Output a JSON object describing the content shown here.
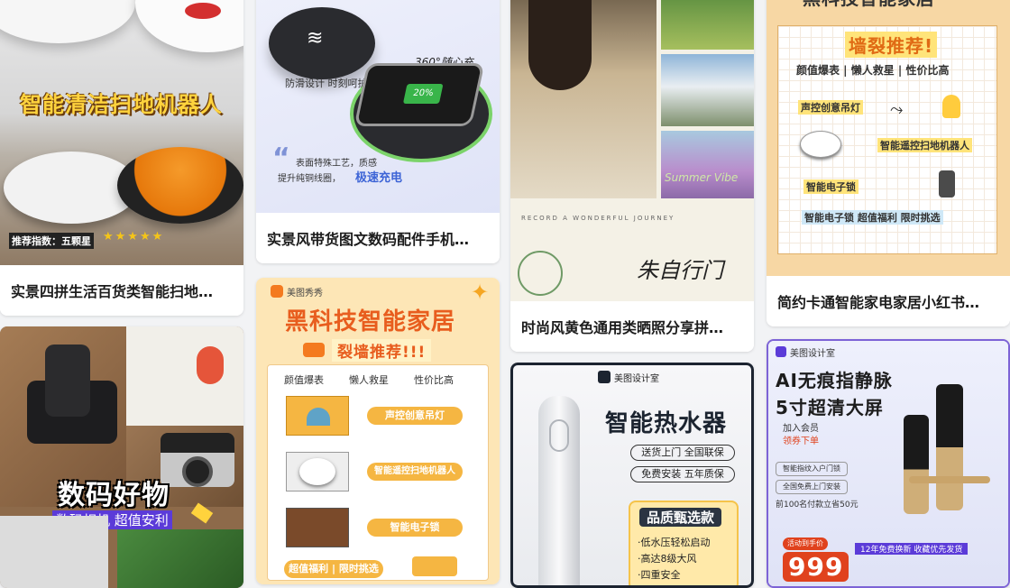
{
  "cards": [
    {
      "title": "实景四拼生活百货类智能扫地…",
      "headline": "智能清洁扫地机器人",
      "rating_label": "推荐指数：五颗星",
      "stars": "★★★★★"
    },
    {
      "title": "数码好物",
      "headline": "数码好物",
      "subline": "数码相机 超值安利"
    },
    {
      "title": "实景风带货图文数码配件手机…",
      "badge": "360°随心充",
      "line1": "防滑设计 时刻呵护",
      "line2a": "表面特殊工艺，质感",
      "line2b": "提升纯铜线圈，",
      "line2c": "极速充电",
      "battery": "20%"
    },
    {
      "title": "黑科技智能家居",
      "brand": "美图秀秀",
      "headline": "黑科技智能家居",
      "sub": "裂墙推荐!!!",
      "tags": [
        "颜值爆表",
        "懒人救星",
        "性价比高"
      ],
      "items": [
        "声控创意吊灯",
        "智能遥控扫地机器人",
        "智能电子锁"
      ],
      "footer": "超值福利 | 限时挑选"
    },
    {
      "title": "时尚风黄色通用类晒照分享拼…",
      "tagline": "RECORD A WONDERFUL JOURNEY",
      "handwriting": "朱自行门",
      "script": "Summer Vibe"
    },
    {
      "title": "智能热水器",
      "brand": "美图设计室",
      "headline": "智能热水器",
      "pills": [
        "送货上门 全国联保",
        "免费安装 五年质保"
      ],
      "box_title": "品质甄选款",
      "box_lines": [
        "·低水压轻松启动",
        "·高达8级大风",
        "·四重安全"
      ]
    },
    {
      "title": "简约卡通智能家电家居小红书…",
      "top": "黑科技智能家居",
      "headline": "墙裂推荐!",
      "tags": "颜值爆表 | 懒人救星 | 性价比高",
      "items": [
        "声控创意吊灯",
        "智能遥控扫地机器人",
        "智能电子锁"
      ],
      "footer": "智能电子锁 超值福利 限时挑选"
    },
    {
      "title": "AI无痕指静脉",
      "brand": "美图设计室",
      "headline1": "AI无痕指静脉",
      "headline2": "5寸超清大屏",
      "member": "加入会员",
      "member2": "领券下单",
      "features": [
        "智能指纹入户门锁",
        "全国免费上门安装",
        "前100名付款立省50元"
      ],
      "promo": "活动到手价",
      "price": "999",
      "strip": "12年免费换新 收藏优先发货"
    }
  ],
  "colors": {
    "orange": "#f47a1f",
    "yellow": "#f7c948",
    "blue": "#3d8bfd",
    "dark": "#1c1c1c"
  }
}
